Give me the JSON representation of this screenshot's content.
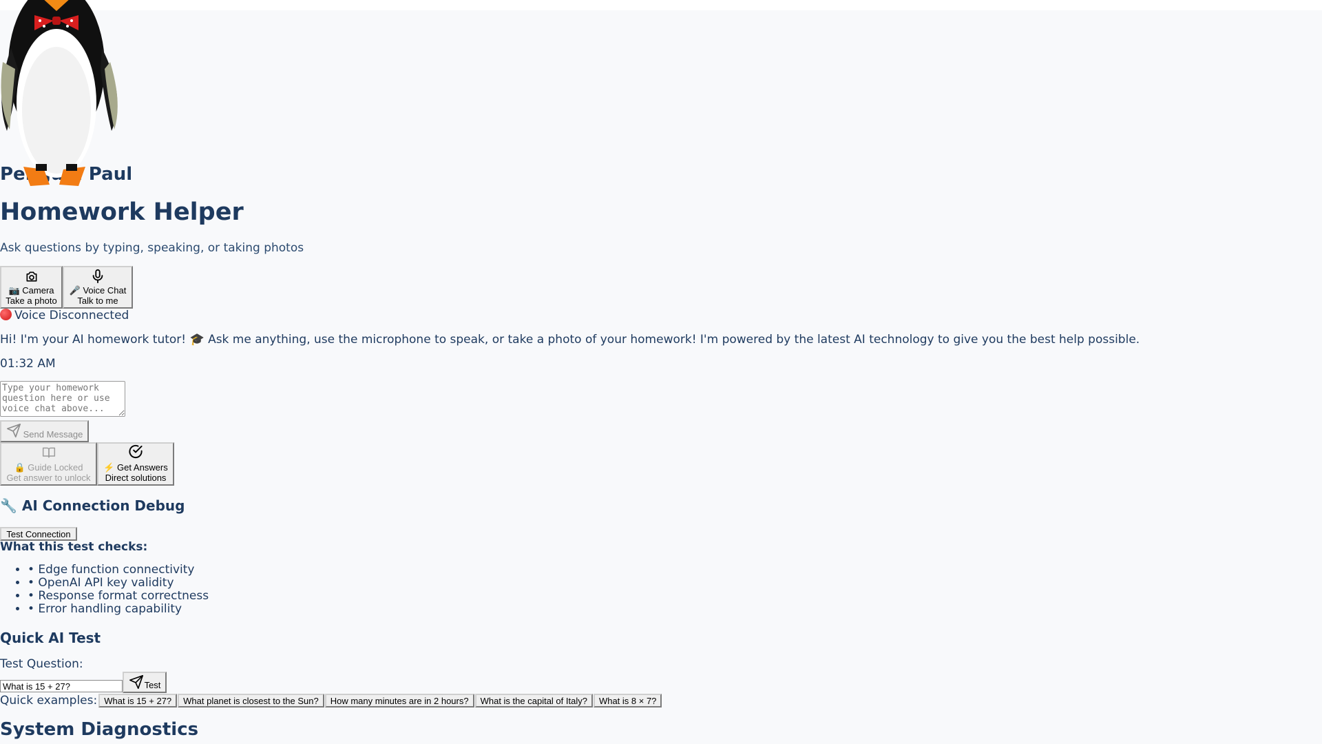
{
  "app": {
    "brand": "Penguin Paul",
    "title": "Homework Helper",
    "subtitle": "Ask questions by typing, speaking, or taking photos"
  },
  "modes": {
    "camera": {
      "label": "📷 Camera",
      "sub": "Take a photo",
      "icon": "camera-icon"
    },
    "voice": {
      "label": "🎤 Voice Chat",
      "sub": "Talk to me",
      "icon": "microphone-icon"
    }
  },
  "voice_status": "Voice Disconnected",
  "chat": {
    "welcome": "Hi! I'm your AI homework tutor! 🎓 Ask me anything, use the microphone to speak, or take a photo of your homework! I'm powered by the latest AI technology to give you the best help possible.",
    "time": "01:32 AM",
    "input_placeholder": "Type your homework question here or use voice chat above...",
    "send_label": "Send Message"
  },
  "cards": {
    "guide": {
      "label": "🔒 Guide Locked",
      "sub": "Get answer to unlock",
      "icon": "book-icon"
    },
    "answers": {
      "label": "⚡ Get Answers",
      "sub": "Direct solutions",
      "icon": "check-circle-icon"
    }
  },
  "debug": {
    "title": "🔧 AI Connection Debug",
    "test_button": "Test Connection",
    "checks_title": "What this test checks:",
    "checks": [
      "• Edge function connectivity",
      "• OpenAI API key validity",
      "• Response format correctness",
      "• Error handling capability"
    ]
  },
  "quick_test": {
    "title": "Quick AI Test",
    "label": "Test Question:",
    "value": "What is 15 + 27?",
    "send_label": "Test",
    "examples_label": "Quick examples:",
    "examples": [
      "What is 15 + 27?",
      "What planet is closest to the Sun?",
      "How many minutes are in 2 hours?",
      "What is the capital of Italy?",
      "What is 8 × 7?"
    ]
  },
  "diagnostics": {
    "title": "System Diagnostics"
  },
  "colors": {
    "heading": "#1e3a5f",
    "background": "#f8f9fb",
    "status_dot": "#d01818"
  }
}
